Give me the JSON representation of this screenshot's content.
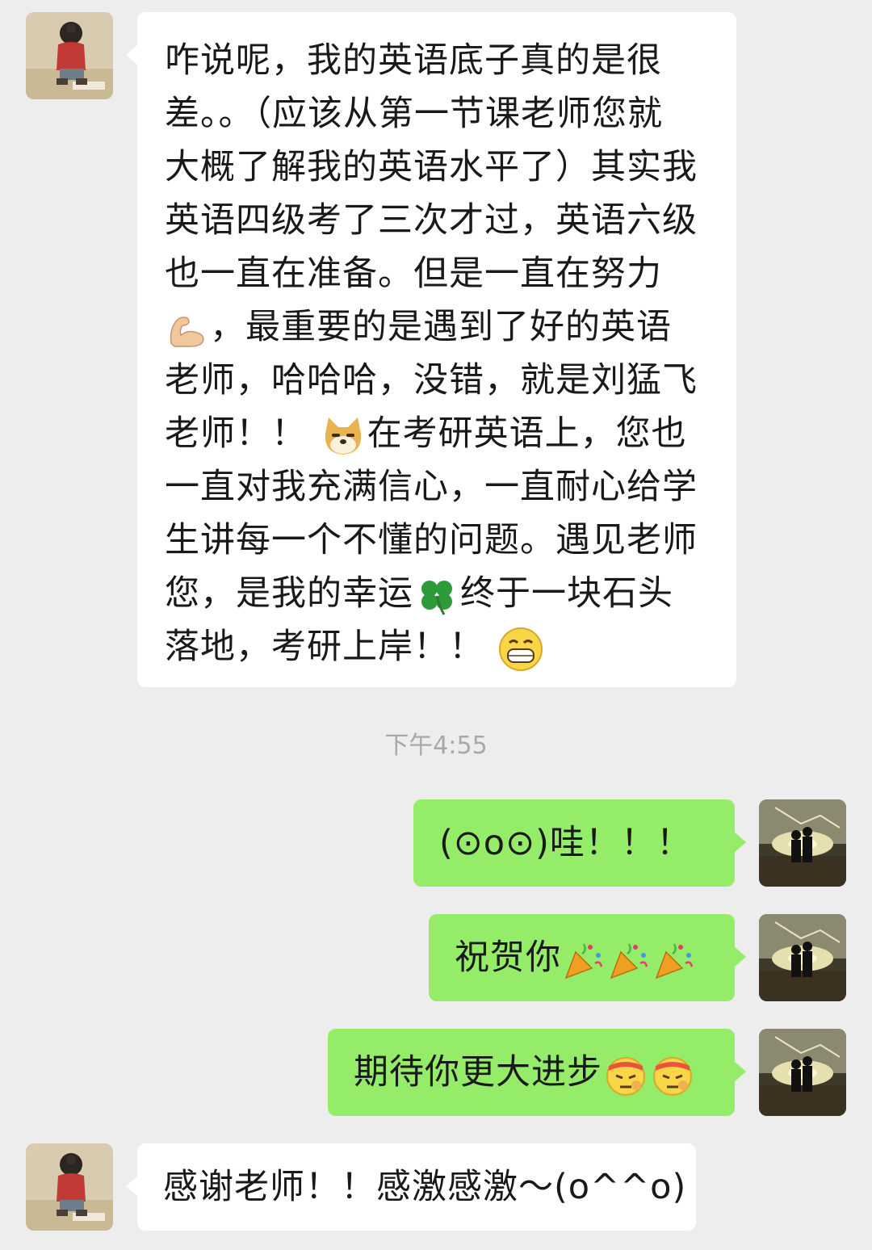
{
  "messages": [
    {
      "side": "left",
      "lines": [
        "咋说呢，我的英语底子真的是很",
        "差。。（应该从第一节课老师您就",
        "大概了解我的英语水平了）其实我",
        "英语四级考了三次才过，英语六级",
        "也一直在准备。但是一直在努力",
        "，最重要的是遇到了好的英语",
        "老师，哈哈哈，没错，就是刘猛飞",
        "老师！！",
        "在考研英语上，您也",
        "一直对我充满信心，一直耐心给学",
        "生讲每一个不懂的问题。遇见老师",
        "您，是我的幸运",
        "终于一块石头",
        "落地，考研上岸！！"
      ],
      "emojis": [
        "flexed-biceps-emoji",
        "doge-emoji",
        "four-leaf-clover-emoji",
        "grinning-face-emoji"
      ]
    }
  ],
  "timestamp": "下午4:55",
  "replies": [
    {
      "text": "(⊙o⊙)哇！！！"
    },
    {
      "text": "祝贺你",
      "emojis": [
        "party-popper-emoji",
        "party-popper-emoji",
        "party-popper-emoji"
      ]
    },
    {
      "text": "期待你更大进步",
      "emojis": [
        "determined-face-emoji",
        "determined-face-emoji"
      ]
    }
  ],
  "last_message": {
    "text": "感谢老师！！感激感激～(o^^o)"
  },
  "colors": {
    "background": "#ededed",
    "received_bubble": "#ffffff",
    "sent_bubble": "#95ec69",
    "text": "#191919",
    "timestamp": "#a8a8a8"
  }
}
